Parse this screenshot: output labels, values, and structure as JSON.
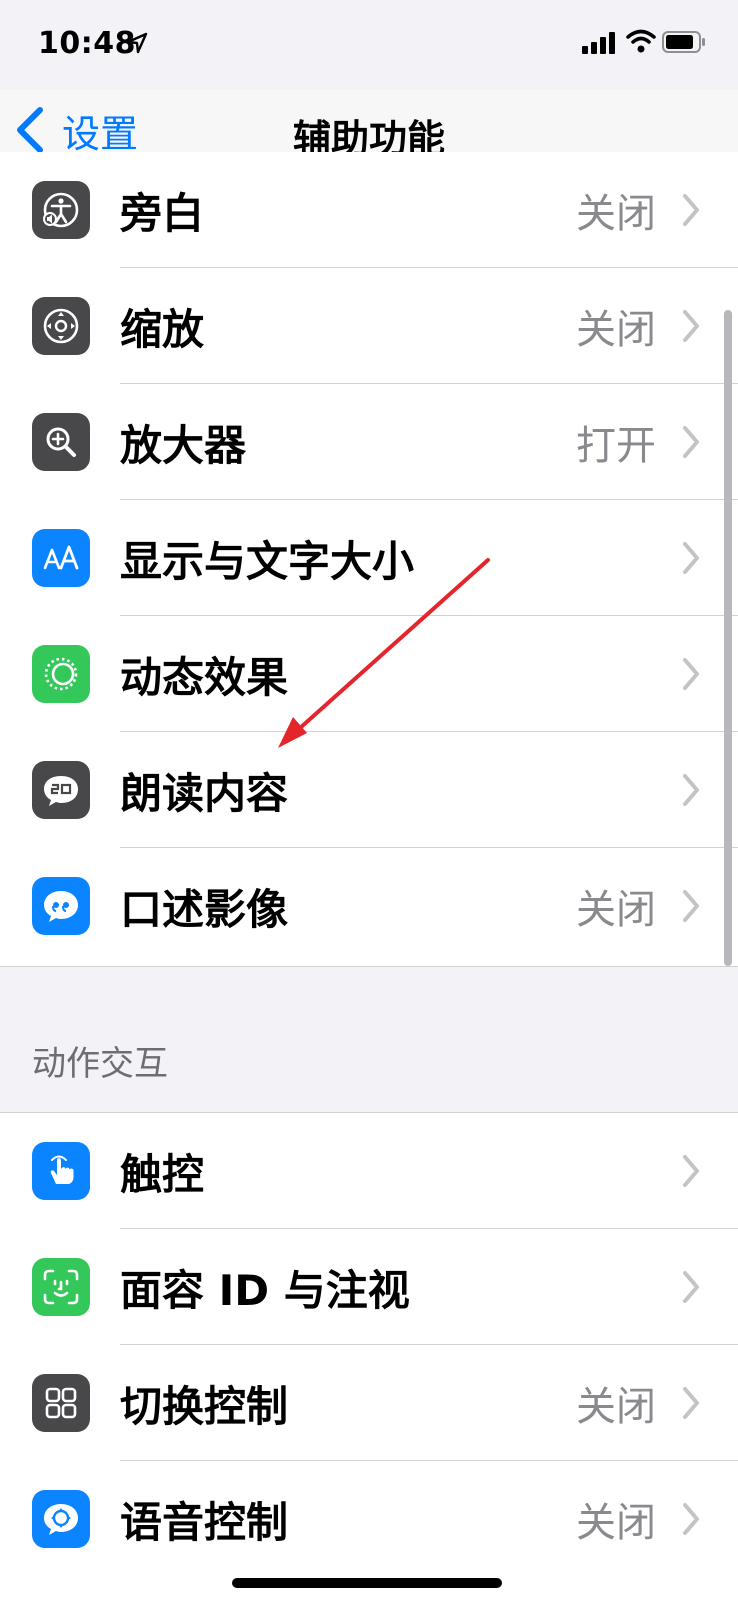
{
  "status_bar": {
    "time": "10:48"
  },
  "nav": {
    "back_label": "设置",
    "title": "辅助功能"
  },
  "colors": {
    "accent": "#007aff",
    "gray_tile": "#48484a",
    "blue_tile": "#0a84ff",
    "green_tile": "#34c759",
    "annotation_arrow": "#e4262c"
  },
  "group_vision": {
    "rows": [
      {
        "label": "旁白",
        "value": "关闭",
        "icon": "voiceover-icon"
      },
      {
        "label": "缩放",
        "value": "关闭",
        "icon": "zoom-icon"
      },
      {
        "label": "放大器",
        "value": "打开",
        "icon": "magnifier-icon"
      },
      {
        "label": "显示与文字大小",
        "value": "",
        "icon": "text-size-icon"
      },
      {
        "label": "动态效果",
        "value": "",
        "icon": "motion-icon"
      },
      {
        "label": "朗读内容",
        "value": "",
        "icon": "spoken-content-icon"
      },
      {
        "label": "口述影像",
        "value": "关闭",
        "icon": "audio-descriptions-icon"
      }
    ]
  },
  "section_interaction": {
    "header": "动作交互",
    "rows": [
      {
        "label": "触控",
        "value": "",
        "icon": "touch-icon"
      },
      {
        "label": "面容 ID 与注视",
        "value": "",
        "icon": "face-id-icon"
      },
      {
        "label": "切换控制",
        "value": "关闭",
        "icon": "switch-control-icon"
      },
      {
        "label": "语音控制",
        "value": "关闭",
        "icon": "voice-control-icon"
      }
    ]
  }
}
